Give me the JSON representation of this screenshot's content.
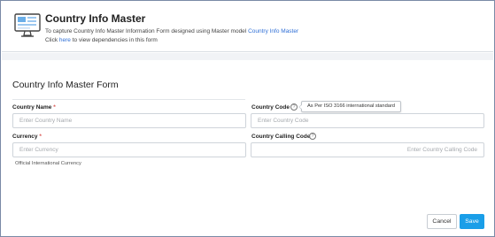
{
  "header": {
    "title": "Country Info Master",
    "line1_prefix": "To capture Country Info Master Information Form designed using Master model ",
    "line1_link": "Country Info Master",
    "line2_prefix": "Click ",
    "line2_link": "here",
    "line2_suffix": " to view dependencies in this form",
    "icon": "desktop-form-icon"
  },
  "form": {
    "title": "Country Info Master Form",
    "country_name": {
      "label": "Country Name",
      "required_mark": "*",
      "placeholder": "Enter Country Name",
      "value": ""
    },
    "country_code": {
      "label": "Country Code",
      "placeholder": "Enter Country Code",
      "value": "",
      "tooltip": "As Per ISO 3166 international standard",
      "help_icon": "question-circle-icon"
    },
    "currency": {
      "label": "Currency",
      "required_mark": "*",
      "placeholder": "Enter Currency",
      "value": "",
      "hint": "Official International Currency"
    },
    "calling_code": {
      "label": "Country Calling Code",
      "placeholder": "Enter Country Calling Code",
      "value": "",
      "help_icon": "question-circle-icon"
    }
  },
  "actions": {
    "cancel": "Cancel",
    "save": "Save"
  },
  "colors": {
    "primary": "#1a9ee8",
    "link": "#2f6fd6",
    "required": "#d9534f",
    "frame": "#7a8aa6"
  }
}
